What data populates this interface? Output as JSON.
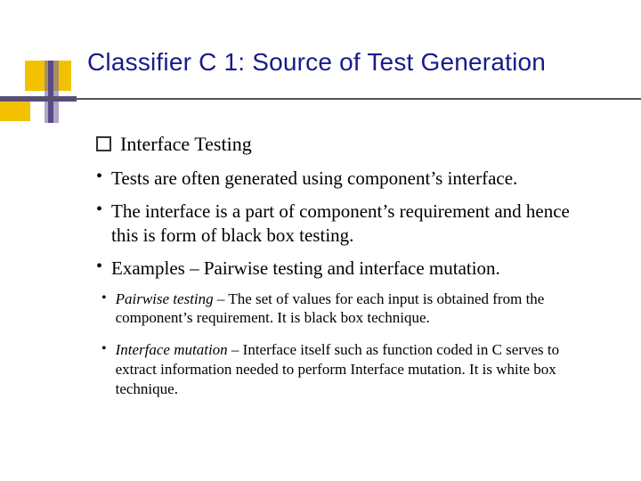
{
  "title": "Classifier C 1: Source of Test Generation",
  "bullets": [
    {
      "level": 1,
      "text": "Interface Testing"
    },
    {
      "level": 2,
      "text": "Tests are often generated using component’s interface."
    },
    {
      "level": 2,
      "text": "The interface is a part of component’s requirement and hence this is form of black box testing."
    },
    {
      "level": 2,
      "text": "Examples – Pairwise testing and interface mutation."
    },
    {
      "level": 3,
      "term": "Pairwise testing",
      "rest": "– The set of values for each input is obtained from the component’s requirement. It is black box technique."
    },
    {
      "level": 3,
      "term": "Interface mutation",
      "rest": "– Interface itself such as function coded in C serves to extract information needed to perform Interface mutation. It is white box technique."
    }
  ],
  "colors": {
    "title": "#1a1a8a",
    "accent_yellow": "#f2c200",
    "accent_purple": "#5a4a88"
  }
}
